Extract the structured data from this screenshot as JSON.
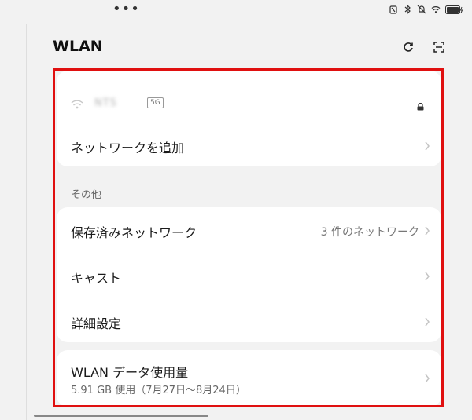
{
  "status_bar": {
    "dots": "•••",
    "icons": [
      "nfc-icon",
      "bluetooth-icon",
      "silent-icon",
      "wifi-icon",
      "battery-icon"
    ]
  },
  "header": {
    "title": "WLAN"
  },
  "current_network": {
    "ssid": "NTS",
    "band": "5G"
  },
  "add_network_label": "ネットワークを追加",
  "section_other": "その他",
  "saved_networks": {
    "label": "保存済みネットワーク",
    "count_text": "3 件のネットワーク"
  },
  "cast_label": "キャスト",
  "advanced_label": "詳細設定",
  "data_usage": {
    "label": "WLAN データ使用量",
    "detail": "5.91 GB 使用（7月27日～8月24日）"
  },
  "colors": {
    "highlight_border": "#e01010",
    "card_bg": "#ffffff",
    "page_bg": "#f2f2f2"
  }
}
